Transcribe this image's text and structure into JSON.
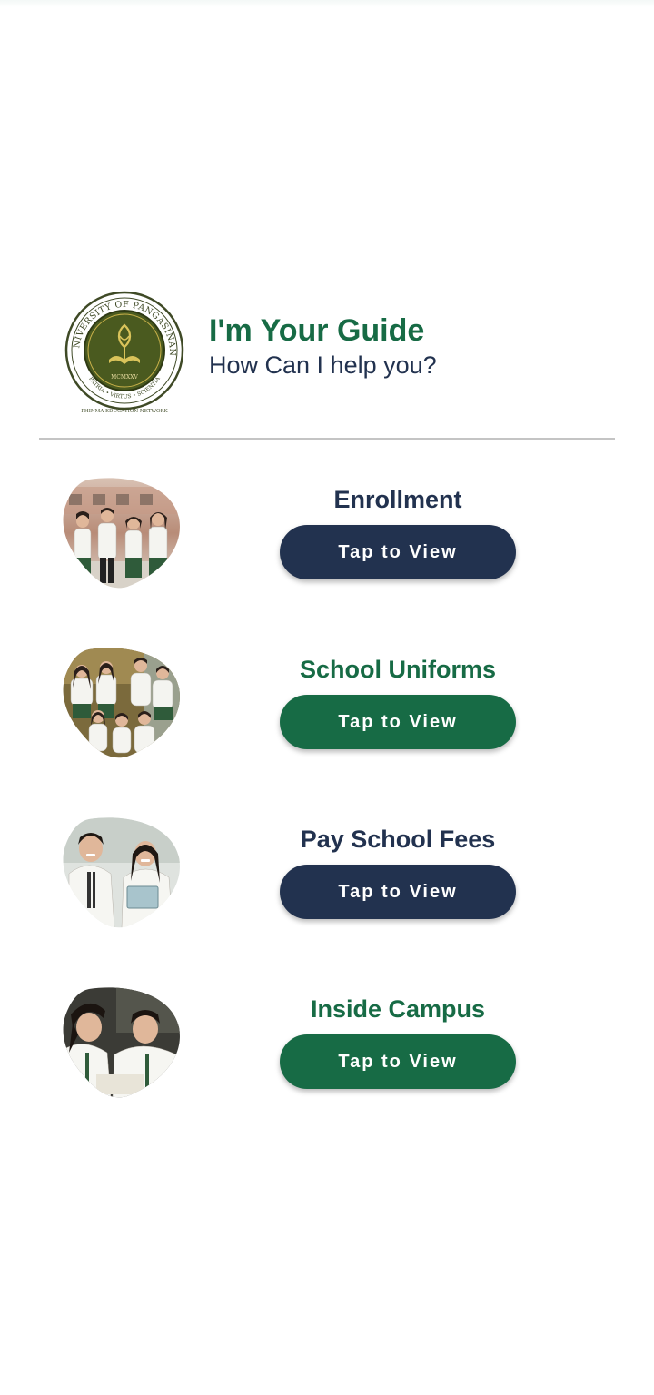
{
  "header": {
    "title": "I'm Your Guide",
    "subtitle": "How Can I help you?",
    "logo": {
      "ring_text": "UNIVERSITY OF PANGASINAN",
      "motto": "PATRIA • VIRTUS • SCIENTIA",
      "year": "MCMXXV",
      "network": "PHINMA EDUCATION NETWORK"
    }
  },
  "items": [
    {
      "title": "Enrollment",
      "button_label": "Tap to View",
      "accent": "#22324f"
    },
    {
      "title": "School Uniforms",
      "button_label": "Tap to View",
      "accent": "#176b45"
    },
    {
      "title": "Pay School Fees",
      "button_label": "Tap to View",
      "accent": "#22324f"
    },
    {
      "title": "Inside Campus",
      "button_label": "Tap to View",
      "accent": "#176b45"
    }
  ],
  "colors": {
    "brand_green": "#176b45",
    "navy": "#22324f",
    "divider": "#c4c4c4"
  }
}
